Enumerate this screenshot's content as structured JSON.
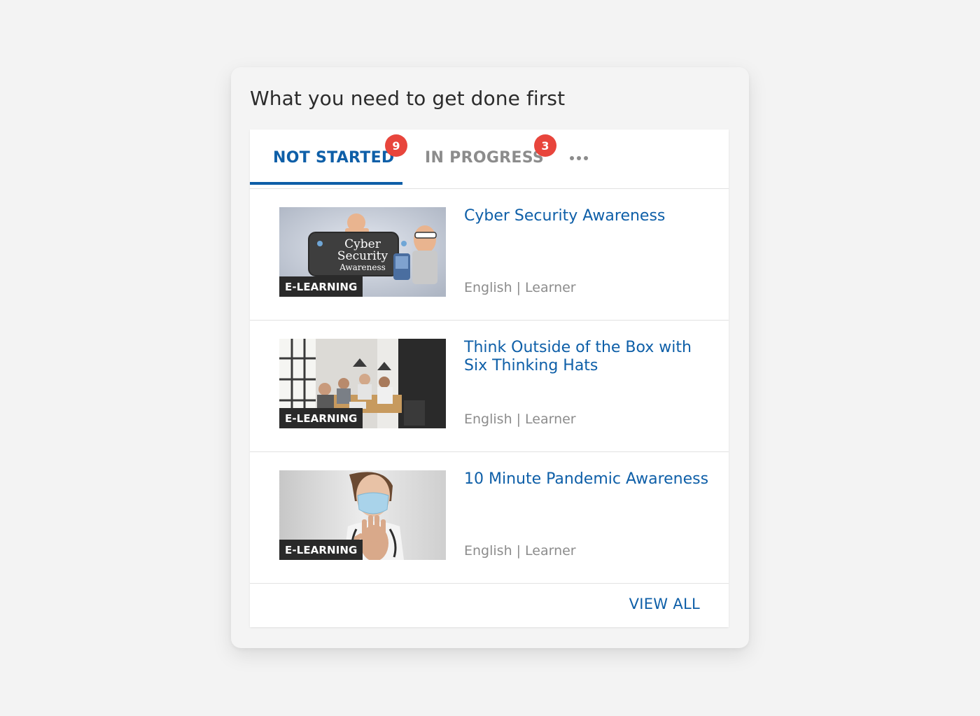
{
  "widget": {
    "title": "What you need to get done first"
  },
  "tabs": [
    {
      "label": "NOT STARTED",
      "badge": "9"
    },
    {
      "label": "IN PROGRESS",
      "badge": "3"
    }
  ],
  "items": [
    {
      "tag": "E-LEARNING",
      "title": "Cyber Security Awareness",
      "language": "English",
      "separator": "|",
      "role": "Learner",
      "thumb_text": [
        "Cyber",
        "Security",
        "Awareness"
      ]
    },
    {
      "tag": "E-LEARNING",
      "title": "Think Outside of the Box with Six Thinking Hats",
      "language": "English",
      "separator": "|",
      "role": "Learner"
    },
    {
      "tag": "E-LEARNING",
      "title": "10 Minute Pandemic Awareness",
      "language": "English",
      "separator": "|",
      "role": "Learner"
    }
  ],
  "footer": {
    "view_all_label": "VIEW ALL"
  },
  "colors": {
    "accent": "#0e5fa8",
    "badge": "#e8453c",
    "muted": "#8c8c8c"
  }
}
